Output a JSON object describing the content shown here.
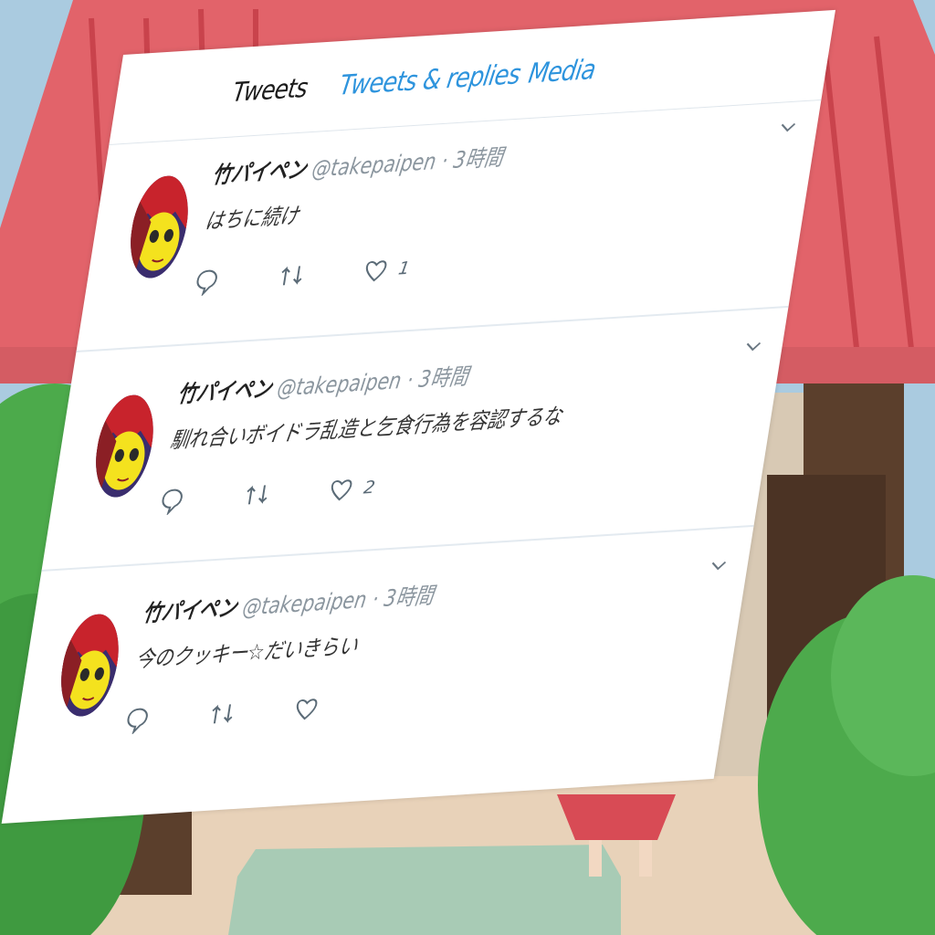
{
  "profile": {
    "tabs": [
      {
        "label": "Tweets",
        "active": true
      },
      {
        "label": "Tweets & replies",
        "active": false
      },
      {
        "label": "Media",
        "active": false
      }
    ]
  },
  "tweets": [
    {
      "name": "竹パイペン",
      "handle": "@takepaipen",
      "separator": "·",
      "time": "3時間",
      "text": "はちに続け",
      "likes": "1"
    },
    {
      "name": "竹パイペン",
      "handle": "@takepaipen",
      "separator": "·",
      "time": "3時間",
      "text": "馴れ合いボイドラ乱造と乞食行為を容認するな",
      "likes": "2"
    },
    {
      "name": "竹パイペン",
      "handle": "@takepaipen",
      "separator": "·",
      "time": "3時間",
      "text": "今のクッキー☆だいきらい",
      "likes": ""
    }
  ],
  "icons": {
    "menu": "chevron-down-icon",
    "reply": "reply-icon",
    "retweet": "retweet-icon",
    "like": "heart-icon"
  },
  "colors": {
    "tab_link": "#2e94dd",
    "roof": "#e0646b",
    "bush": "#4ca84a",
    "sky": "#a9c9dc"
  }
}
